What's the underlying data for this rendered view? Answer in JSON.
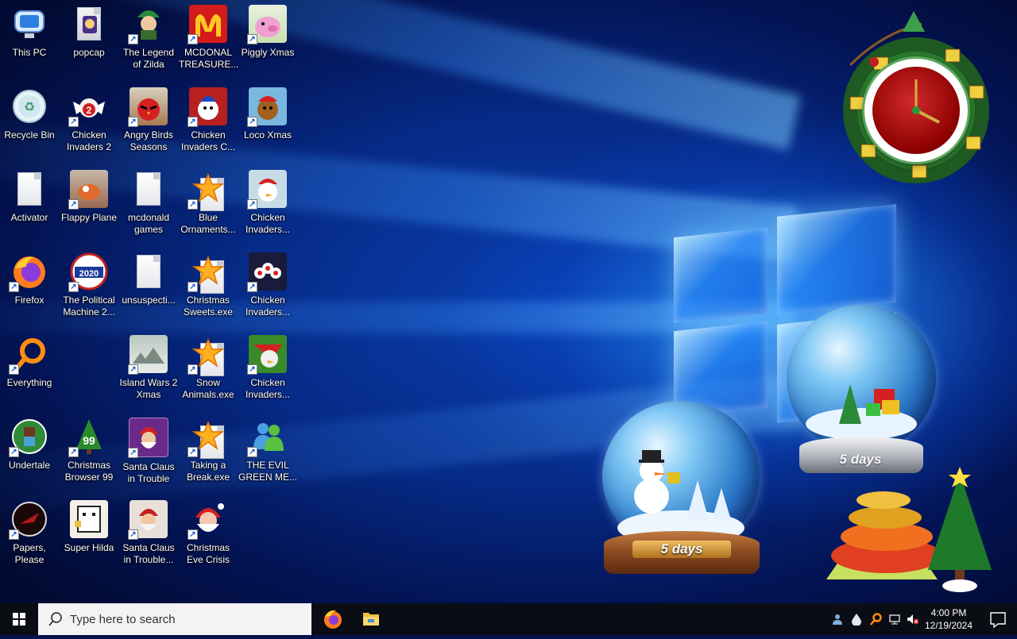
{
  "desktop": {
    "icons": [
      {
        "label": "This PC",
        "icon": "computer-icon"
      },
      {
        "label": "Recycle Bin",
        "icon": "recycle-bin-icon"
      },
      {
        "label": "Activator",
        "icon": "file-icon"
      },
      {
        "label": "Firefox",
        "icon": "firefox-icon"
      },
      {
        "label": "Everything",
        "icon": "everything-search-icon"
      },
      {
        "label": "Undertale",
        "icon": "undertale-icon"
      },
      {
        "label": "Papers, Please",
        "icon": "papers-please-icon"
      },
      {
        "label": "popcap",
        "icon": "popcap-icon"
      },
      {
        "label": "Chicken Invaders 2",
        "icon": "chicken-invaders-2-icon"
      },
      {
        "label": "Flappy Plane",
        "icon": "flappy-plane-icon"
      },
      {
        "label": "The Political Machine 2...",
        "icon": "political-machine-icon"
      },
      {
        "label": "Christmas Browser 99",
        "icon": "christmas-browser-icon"
      },
      {
        "label": "Super Hilda",
        "icon": "super-hilda-icon"
      },
      {
        "label": "The Legend of Zilda",
        "icon": "legend-of-zilda-icon"
      },
      {
        "label": "Angry Birds Seasons",
        "icon": "angry-birds-icon"
      },
      {
        "label": "mcdonald games",
        "icon": "folder-icon"
      },
      {
        "label": "unsuspecti...",
        "icon": "file-icon"
      },
      {
        "label": "Island Wars 2 Xmas",
        "icon": "island-wars-icon"
      },
      {
        "label": "Santa Claus in Trouble",
        "icon": "santa-claus-icon"
      },
      {
        "label": "Santa Claus in Trouble...",
        "icon": "santa-claus-icon"
      },
      {
        "label": "MCDONAL TREASURE...",
        "icon": "mcdonalds-icon"
      },
      {
        "label": "Chicken Invaders C...",
        "icon": "chicken-invaders-icon"
      },
      {
        "label": "Blue Ornaments...",
        "icon": "exe-star-icon"
      },
      {
        "label": "Christmas Sweets.exe",
        "icon": "exe-star-icon"
      },
      {
        "label": "Snow Animals.exe",
        "icon": "exe-star-icon"
      },
      {
        "label": "Taking a Break.exe",
        "icon": "exe-star-icon"
      },
      {
        "label": "Christmas Eve Crisis",
        "icon": "santa-face-icon"
      },
      {
        "label": "Piggly Xmas",
        "icon": "piggly-icon"
      },
      {
        "label": "Loco Xmas",
        "icon": "loco-bear-icon"
      },
      {
        "label": "Chicken Invaders...",
        "icon": "chicken-invaders-icon"
      },
      {
        "label": "Chicken Invaders...",
        "icon": "chicken-invaders-icon"
      },
      {
        "label": "Chicken Invaders...",
        "icon": "chicken-invaders-icon"
      },
      {
        "label": "THE EVIL GREEN ME...",
        "icon": "messenger-icon"
      }
    ]
  },
  "gadgets": {
    "globe_left_label": "5 days",
    "globe_right_label": "5 days"
  },
  "taskbar": {
    "search_placeholder": "Type here to search",
    "pinned": [
      "firefox-icon",
      "file-explorer-icon"
    ],
    "tray": [
      "people-icon",
      "drop-icon",
      "search-tool-icon",
      "network-icon",
      "volume-muted-icon"
    ],
    "time": "4:00 PM",
    "date": "12/19/2024"
  },
  "colors": {
    "taskbar_bg": "#0b0d14",
    "wallpaper_blue": "#0a3fb0",
    "clock_red": "#b01616"
  }
}
